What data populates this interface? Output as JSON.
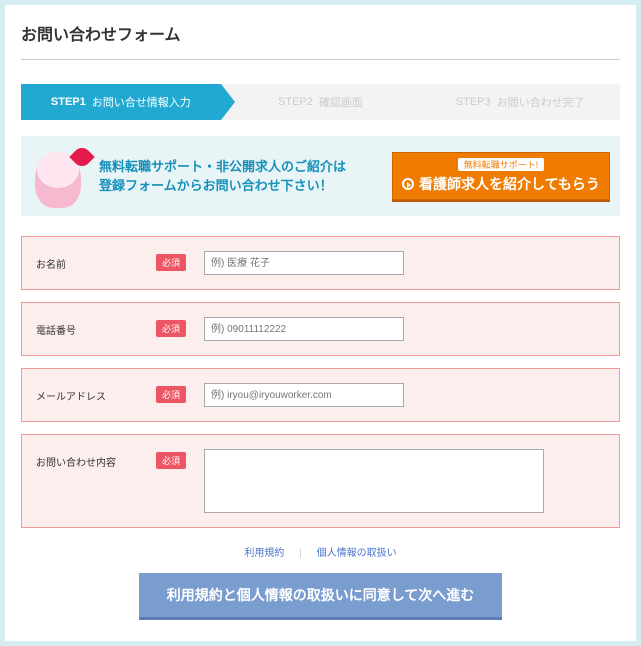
{
  "page_title": "お問い合わせフォーム",
  "steps": [
    {
      "num": "STEP1",
      "label": "お問い合せ情報入力",
      "active": true
    },
    {
      "num": "STEP2",
      "label": "確認画面",
      "active": false
    },
    {
      "num": "STEP3",
      "label": "お問い合わせ完了",
      "active": false
    }
  ],
  "banner": {
    "line1": "無料転職サポート・非公開求人のご紹介は",
    "line2": "登録フォームからお問い合わせ下さい！",
    "btn_small": "無料転職サポート!",
    "btn_big": "看護師求人を紹介してもらう"
  },
  "fields": {
    "name": {
      "label": "お名前",
      "placeholder": "例) 医療 花子"
    },
    "tel": {
      "label": "電話番号",
      "placeholder": "例) 09011112222"
    },
    "mail": {
      "label": "メールアドレス",
      "placeholder": "例) iryou@iryouworker.com"
    },
    "body": {
      "label": "お問い合わせ内容"
    }
  },
  "required_badge": "必須",
  "links": {
    "terms": "利用規約",
    "privacy": "個人情報の取扱い"
  },
  "submit": "利用規約と個人情報の取扱いに同意して次へ進む"
}
